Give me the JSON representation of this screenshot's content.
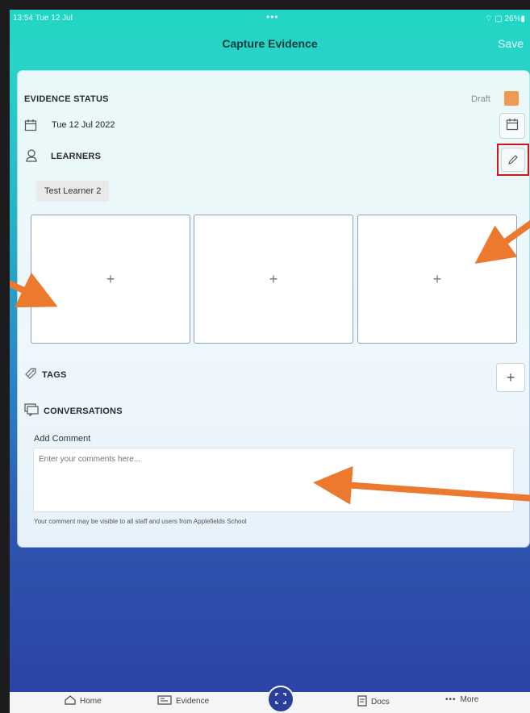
{
  "status_bar": {
    "time": "13:54  Tue 12 Jul",
    "dots": "•••",
    "indicators": "⌔ ▢ 26%▮"
  },
  "nav": {
    "title": "Capture Evidence",
    "save_label": "Save"
  },
  "evidence": {
    "status_label": "EVIDENCE STATUS",
    "status_value": "Draft",
    "status_color": "#f09a4f",
    "date": "Tue 12 Jul 2022",
    "learners_label": "LEARNERS",
    "learners": [
      "Test  Learner 2"
    ],
    "photo_slots": [
      "+",
      "+",
      "+"
    ],
    "tags_label": "TAGS",
    "tags_add": "+",
    "conversations_label": "CONVERSATIONS",
    "add_comment_label": "Add Comment",
    "comment_placeholder": "Enter your comments here...",
    "comment_value": "",
    "comment_note": "Your comment may be visible to all staff and users from Applefields School"
  },
  "tabs": {
    "home": "Home",
    "evidence": "Evidence",
    "docs": "Docs",
    "more": "More"
  },
  "colors": {
    "accent": "#20d6c3",
    "annotation_arrow": "#ec7a2e",
    "annotation_box": "#d0151b",
    "scan_button": "#283f9e"
  }
}
